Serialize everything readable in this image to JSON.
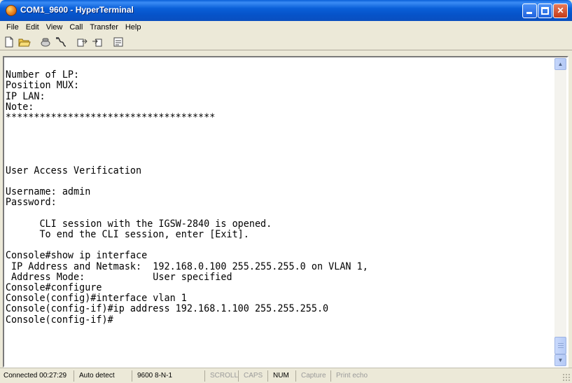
{
  "window": {
    "title": "COM1_9600 - HyperTerminal",
    "icon": "hyperterminal-app-icon"
  },
  "menu": [
    "File",
    "Edit",
    "View",
    "Call",
    "Transfer",
    "Help"
  ],
  "toolbar": [
    "new-icon",
    "open-icon",
    "disconnect-phone-icon",
    "properties-cable-icon",
    "send-icon",
    "receive-icon",
    "settings-icon"
  ],
  "terminal": {
    "lines": [
      "",
      "Number of LP:",
      "Position MUX:",
      "IP LAN:",
      "Note:",
      "*************************************",
      "",
      "",
      "",
      "",
      "User Access Verification",
      "",
      "Username: admin",
      "Password:",
      "",
      "      CLI session with the IGSW-2840 is opened.",
      "      To end the CLI session, enter [Exit].",
      "",
      "Console#show ip interface",
      " IP Address and Netmask:  192.168.0.100 255.255.255.0 on VLAN 1,",
      " Address Mode:            User specified",
      "Console#configure",
      "Console(config)#interface vlan 1",
      "Console(config-if)#ip address 192.168.1.100 255.255.255.0",
      "Console(config-if)#"
    ]
  },
  "status": {
    "connected": "Connected 00:27:29",
    "detect": "Auto detect",
    "port_settings": "9600 8-N-1",
    "scroll": "SCROLL",
    "caps": "CAPS",
    "num": "NUM",
    "capture": "Capture",
    "print_echo": "Print echo"
  },
  "colors": {
    "titlebar": "#0a5fd8",
    "chrome": "#ece9d8",
    "terminal_bg": "#ffffff",
    "terminal_fg": "#000000"
  }
}
